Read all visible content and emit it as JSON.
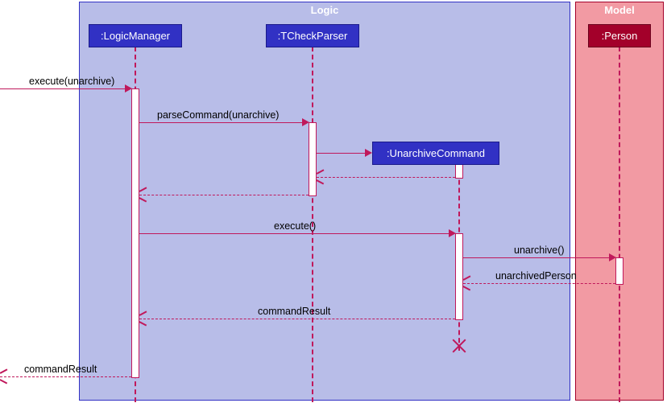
{
  "frames": {
    "logic": {
      "label": "Logic",
      "bg": "#b8bde8",
      "border": "#3131c4",
      "labelColor": "#fff"
    },
    "model": {
      "label": "Model",
      "bg": "#f29aa3",
      "border": "#a3002a",
      "labelColor": "#fff"
    }
  },
  "participants": {
    "logicManager": {
      "label": ":LogicManager",
      "bg": "#3131c4",
      "border": "#1a1a8a"
    },
    "tCheckParser": {
      "label": ":TCheckParser",
      "bg": "#3131c4",
      "border": "#1a1a8a"
    },
    "unarchiveCommand": {
      "label": ":UnarchiveCommand",
      "bg": "#3131c4",
      "border": "#1a1a8a"
    },
    "person": {
      "label": ":Person",
      "bg": "#a3002a",
      "border": "#6b001c"
    }
  },
  "messages": {
    "m1": "execute(unarchive)",
    "m2": "parseCommand(unarchive)",
    "m3": "execute()",
    "m4": "unarchive()",
    "m5": "unarchivedPerson",
    "m6": "commandResult",
    "m7": "commandResult"
  },
  "chart_data": {
    "type": "sequence-diagram",
    "frames": [
      {
        "name": "Logic",
        "participants": [
          "LogicManager",
          "TCheckParser",
          "UnarchiveCommand"
        ]
      },
      {
        "name": "Model",
        "participants": [
          "Person"
        ]
      }
    ],
    "participants": [
      {
        "id": "LogicManager",
        "label": ":LogicManager",
        "createdAt": 0
      },
      {
        "id": "TCheckParser",
        "label": ":TCheckParser",
        "createdAt": 0
      },
      {
        "id": "UnarchiveCommand",
        "label": ":UnarchiveCommand",
        "createdAt": 3,
        "destroyedAt": 9
      },
      {
        "id": "Person",
        "label": ":Person",
        "createdAt": 0
      }
    ],
    "messages": [
      {
        "seq": 1,
        "from": "external",
        "to": "LogicManager",
        "label": "execute(unarchive)",
        "type": "sync"
      },
      {
        "seq": 2,
        "from": "LogicManager",
        "to": "TCheckParser",
        "label": "parseCommand(unarchive)",
        "type": "sync"
      },
      {
        "seq": 3,
        "from": "TCheckParser",
        "to": "UnarchiveCommand",
        "label": "",
        "type": "create"
      },
      {
        "seq": 4,
        "from": "UnarchiveCommand",
        "to": "TCheckParser",
        "label": "",
        "type": "return"
      },
      {
        "seq": 5,
        "from": "TCheckParser",
        "to": "LogicManager",
        "label": "",
        "type": "return"
      },
      {
        "seq": 6,
        "from": "LogicManager",
        "to": "UnarchiveCommand",
        "label": "execute()",
        "type": "sync"
      },
      {
        "seq": 7,
        "from": "UnarchiveCommand",
        "to": "Person",
        "label": "unarchive()",
        "type": "sync"
      },
      {
        "seq": 8,
        "from": "Person",
        "to": "UnarchiveCommand",
        "label": "unarchivedPerson",
        "type": "return"
      },
      {
        "seq": 9,
        "from": "UnarchiveCommand",
        "to": "LogicManager",
        "label": "commandResult",
        "type": "return"
      },
      {
        "seq": 10,
        "from": "LogicManager",
        "to": "external",
        "label": "commandResult",
        "type": "return"
      }
    ]
  }
}
